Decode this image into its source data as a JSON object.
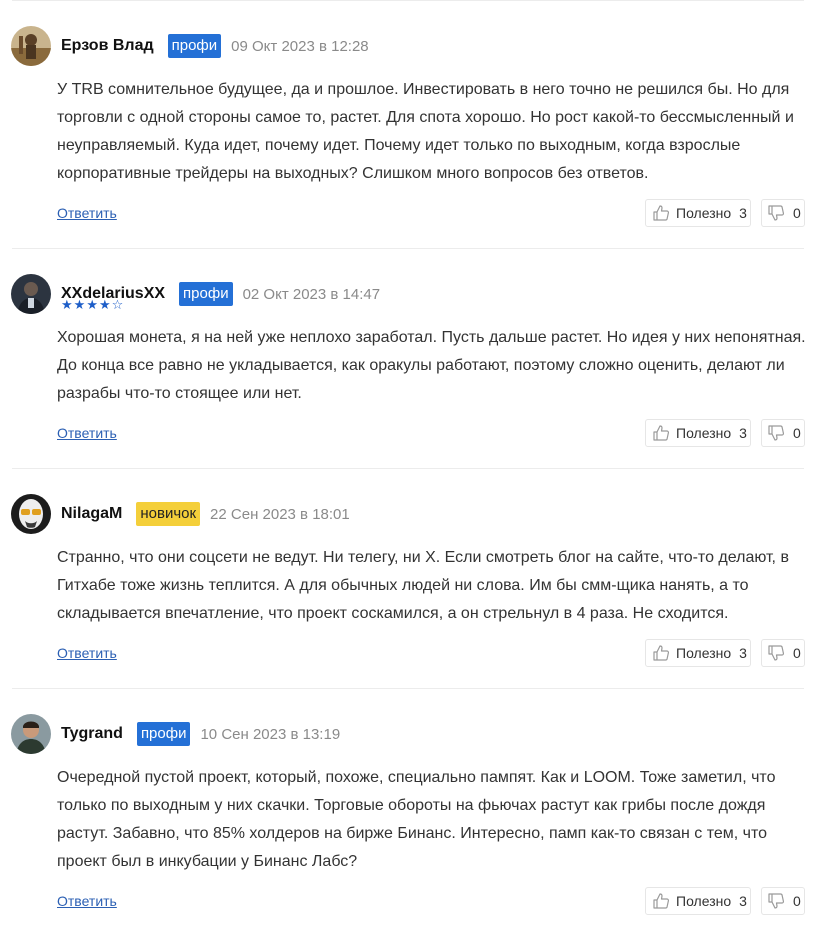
{
  "comments": [
    {
      "author": "Ерзов Влад",
      "badge": "профи",
      "badge_type": "pro",
      "date": "09 Окт 2023 в 12:28",
      "rating_stars": null,
      "text": "У TRB сомнительное будущее, да и прошлое. Инвестировать в него точно не решился бы. Но для торговли с одной стороны самое то, растет. Для спота хорошо. Но рост какой-то бессмысленный и неуправляемый. Куда идет, почему идет. Почему идет только по выходным, когда взрослые корпоративные трейдеры на выходных? Слишком много вопросов без ответов.",
      "reply_label": "Ответить",
      "useful_label": "Полезно",
      "useful_count": "3",
      "dislike_count": "0"
    },
    {
      "author": "XXdelariusXX",
      "badge": "профи",
      "badge_type": "pro",
      "date": "02 Окт 2023 в 14:47",
      "rating_stars": 4,
      "rating_max": 5,
      "text": "Хорошая монета, я на ней уже неплохо заработал. Пусть дальше растет. Но идея у них непонятная. До конца все равно не укладывается, как оракулы работают, поэтому сложно оценить, делают ли разрабы что-то стоящее или нет.",
      "reply_label": "Ответить",
      "useful_label": "Полезно",
      "useful_count": "3",
      "dislike_count": "0"
    },
    {
      "author": "NilagaM",
      "badge": "новичок",
      "badge_type": "new",
      "date": "22 Сен 2023 в 18:01",
      "rating_stars": null,
      "text": "Странно, что они соцсети не ведут. Ни телегу, ни Х. Если смотреть блог на сайте, что-то делают, в Гитхабе тоже жизнь теплится. А для обычных людей ни слова. Им бы смм-щика нанять, а то складывается впечатление, что проект соскамился, а он стрельнул в 4 раза. Не сходится.",
      "reply_label": "Ответить",
      "useful_label": "Полезно",
      "useful_count": "3",
      "dislike_count": "0"
    },
    {
      "author": "Tygrand",
      "badge": "профи",
      "badge_type": "pro",
      "date": "10 Сен 2023 в 13:19",
      "rating_stars": null,
      "text": "Очередной пустой проект, который, похоже, специально пампят. Как и LOOM. Тоже заметил, что только по выходным у них скачки. Торговые обороты на фьючах растут как грибы после дождя растут. Забавно, что 85% холдеров на бирже Бинанс. Интересно, памп как-то связан с тем, что проект был в инкубации у Бинанс Лабс?",
      "reply_label": "Ответить",
      "useful_label": "Полезно",
      "useful_count": "3",
      "dislike_count": "0"
    }
  ],
  "colors": {
    "badge_pro": "#2470d6",
    "badge_new": "#f4cf3a",
    "link": "#2b5fb3",
    "star": "#1e5ec8"
  },
  "icons": {
    "like": "thumbs-up-icon",
    "dislike": "thumbs-down-icon"
  }
}
